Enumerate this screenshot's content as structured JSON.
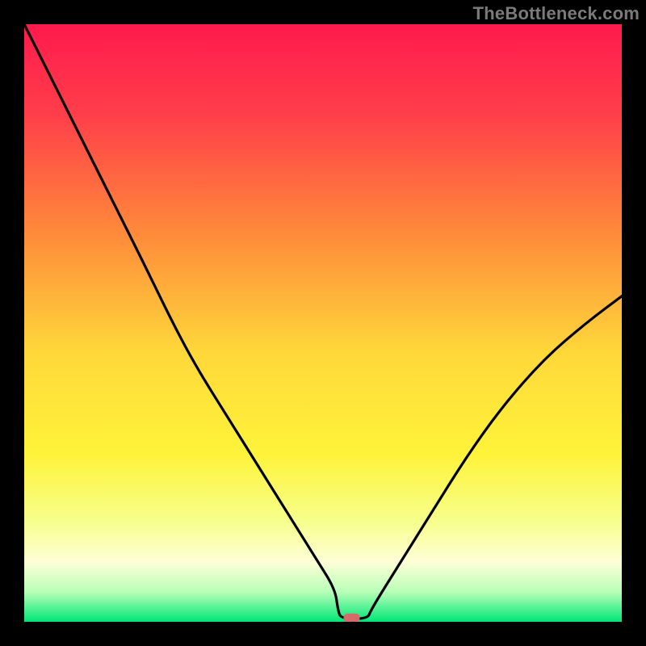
{
  "watermark": "TheBottleneck.com",
  "marker": {
    "x_frac": 0.548,
    "color": "#d46a6a"
  },
  "chart_data": {
    "type": "line",
    "title": "",
    "xlabel": "",
    "ylabel": "",
    "xlim": [
      0,
      1
    ],
    "ylim": [
      0,
      1
    ],
    "grid": false,
    "legend": false,
    "annotations": [
      "TheBottleneck.com"
    ],
    "gradient_stops": [
      {
        "offset": 0.0,
        "color": "#ff1a4d"
      },
      {
        "offset": 0.15,
        "color": "#ff3e4a"
      },
      {
        "offset": 0.35,
        "color": "#ff8a3a"
      },
      {
        "offset": 0.55,
        "color": "#ffd83a"
      },
      {
        "offset": 0.72,
        "color": "#fff33a"
      },
      {
        "offset": 0.83,
        "color": "#f6ff8a"
      },
      {
        "offset": 0.9,
        "color": "#fdffd6"
      },
      {
        "offset": 0.95,
        "color": "#b8ffb8"
      },
      {
        "offset": 1.0,
        "color": "#00e676"
      }
    ],
    "series": [
      {
        "name": "curve",
        "color": "#000000",
        "x": [
          0.0,
          0.05,
          0.1,
          0.15,
          0.2,
          0.25,
          0.29,
          0.34,
          0.39,
          0.44,
          0.49,
          0.52,
          0.525,
          0.53,
          0.575,
          0.58,
          0.63,
          0.68,
          0.74,
          0.8,
          0.87,
          0.94,
          1.0
        ],
        "y": [
          1.0,
          0.9,
          0.8,
          0.7,
          0.6,
          0.497,
          0.423,
          0.343,
          0.263,
          0.183,
          0.103,
          0.055,
          0.02,
          0.005,
          0.005,
          0.02,
          0.1,
          0.18,
          0.276,
          0.36,
          0.44,
          0.5,
          0.545
        ]
      }
    ],
    "marker": {
      "x": 0.548,
      "y": 0.003,
      "color": "#d46a6a"
    }
  }
}
